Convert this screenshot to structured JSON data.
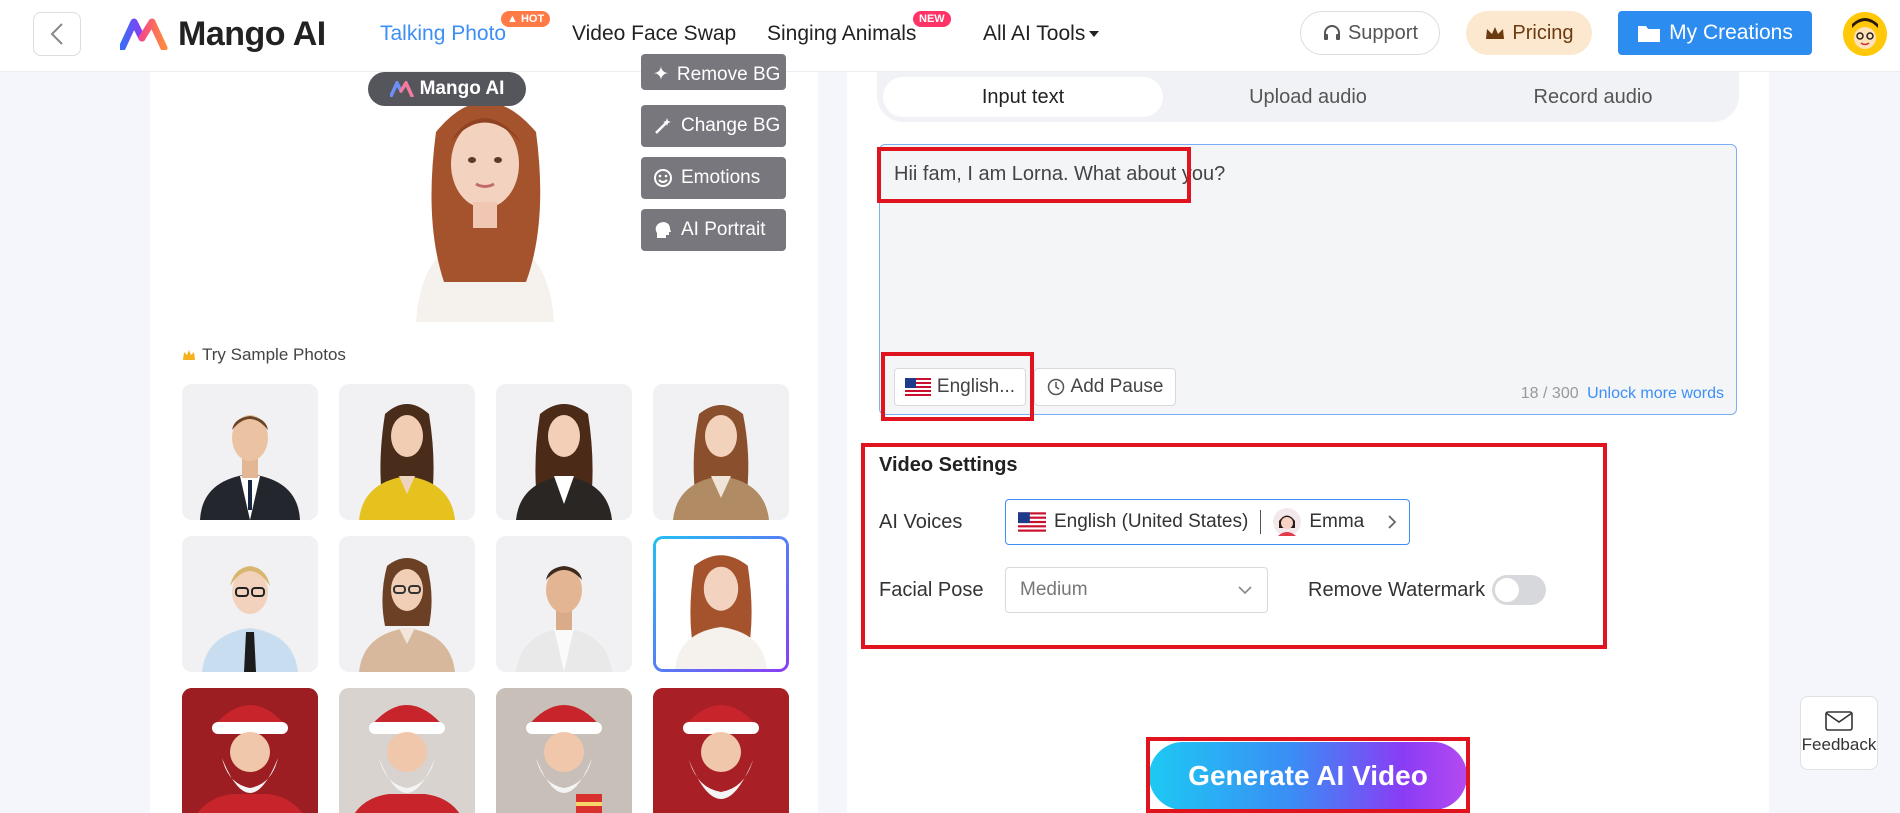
{
  "header": {
    "logo_text": "Mango AI",
    "nav": [
      {
        "label": "Talking Photo",
        "badge": "HOT"
      },
      {
        "label": "Video Face Swap"
      },
      {
        "label": "Singing Animals",
        "badge": "NEW"
      },
      {
        "label": "All AI Tools"
      }
    ],
    "support_label": "Support",
    "pricing_label": "Pricing",
    "creations_label": "My Creations"
  },
  "left": {
    "watermark_text": "Mango AI",
    "tools": [
      "Remove BG",
      "Change BG",
      "Emotions",
      "AI Portrait"
    ],
    "sample_label": "Try Sample Photos"
  },
  "right": {
    "tabs": [
      "Input text",
      "Upload audio",
      "Record audio"
    ],
    "text_input": "Hii fam, I am Lorna. What about you?",
    "language_label": "English...",
    "pause_label": "Add Pause",
    "counter": "18 / 300",
    "unlock_label": "Unlock more words",
    "settings_title": "Video Settings",
    "voices_label": "AI Voices",
    "voice_language": "English (United States)",
    "voice_name": "Emma",
    "pose_label": "Facial Pose",
    "pose_value": "Medium",
    "watermark_label": "Remove Watermark",
    "watermark_on": false,
    "generate_label": "Generate AI Video"
  },
  "feedback_label": "Feedback",
  "colors": {
    "accent": "#2d8cf0",
    "highlight_red": "#e0141e",
    "hot_badge": "#ff7a45",
    "new_badge": "#ff3366"
  }
}
